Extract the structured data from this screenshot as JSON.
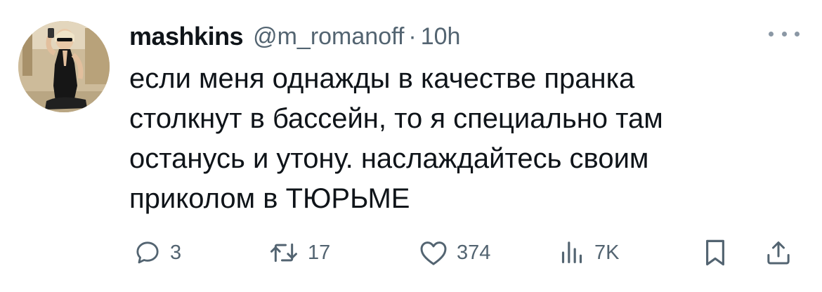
{
  "author": {
    "display_name": "mashkins",
    "handle": "@m_romanoff",
    "separator": "·",
    "time": "10h",
    "avatar_icon": "user-avatar-photo"
  },
  "tweet": {
    "lines": [
      "если меня однажды в качестве пранка",
      "столкнут в бассейн, то я специально там",
      "останусь и утону. наслаждайтесь своим",
      "приколом в ТЮРЬМЕ"
    ]
  },
  "actions": {
    "reply_count": "3",
    "retweet_count": "17",
    "like_count": "374",
    "views_count": "7K"
  },
  "colors": {
    "text": "#0f1419",
    "secondary": "#536471",
    "more_dots": "#8b98a5",
    "background": "#ffffff"
  }
}
